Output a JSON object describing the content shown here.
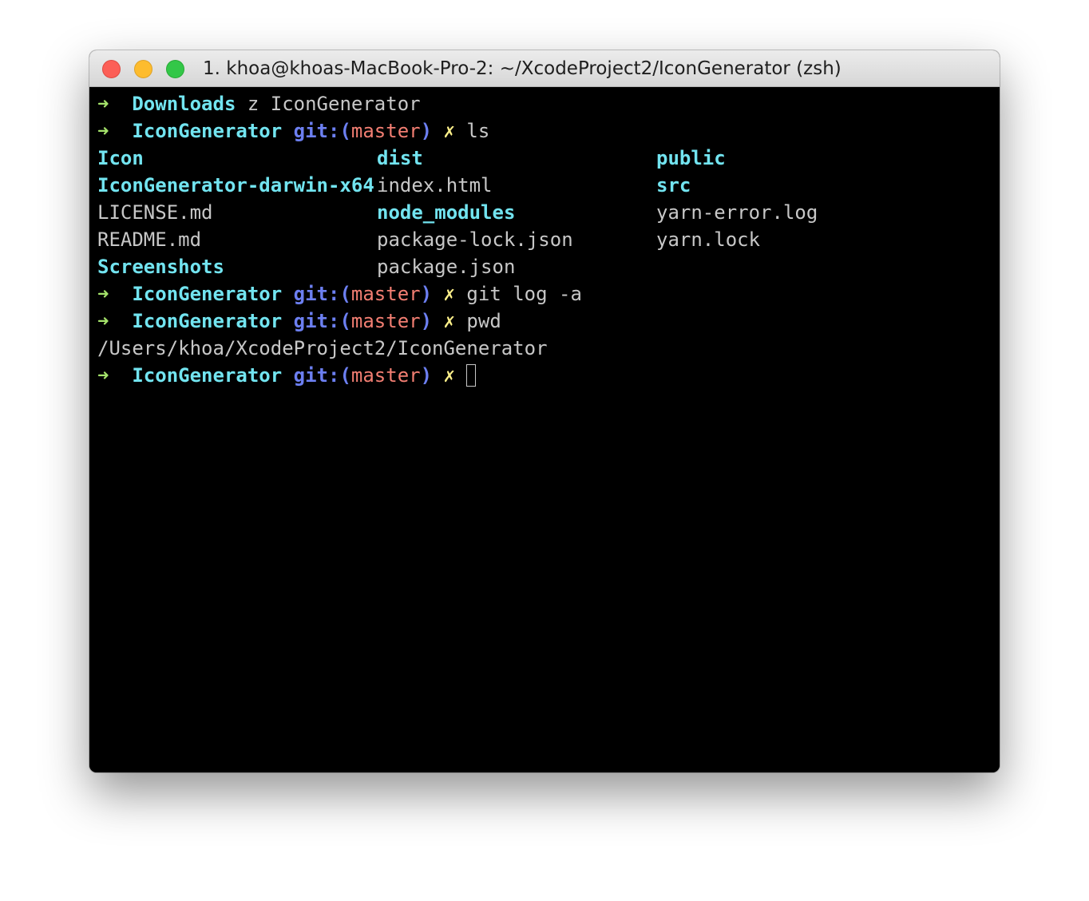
{
  "window": {
    "title": "1. khoa@khoas-MacBook-Pro-2: ~/XcodeProject2/IconGenerator (zsh)"
  },
  "colors": {
    "arrow": "#a5e36b",
    "directory": "#72e4f0",
    "git": "#6c7ff1",
    "branch": "#f27e72",
    "dirty": "#fdf08a",
    "text": "#c7c7c7",
    "background": "#000000"
  },
  "prompt": {
    "arrow": "➜",
    "git_open": "git:(",
    "branch": "master",
    "git_close": ")",
    "dirty": "✗"
  },
  "lines": {
    "l1": {
      "dir": "Downloads",
      "command": "z IconGenerator"
    },
    "l2": {
      "dir": "IconGenerator",
      "command": "ls"
    },
    "l8": {
      "dir": "IconGenerator",
      "command": "git log -a"
    },
    "l9": {
      "dir": "IconGenerator",
      "command": "pwd"
    },
    "l10": {
      "output": "/Users/khoa/XcodeProject2/IconGenerator"
    },
    "l11": {
      "dir": "IconGenerator",
      "command": ""
    }
  },
  "ls_output": [
    [
      "Icon",
      "dist",
      "public"
    ],
    [
      "IconGenerator-darwin-x64",
      "index.html",
      "src"
    ],
    [
      "LICENSE.md",
      "node_modules",
      "yarn-error.log"
    ],
    [
      "README.md",
      "package-lock.json",
      "yarn.lock"
    ],
    [
      "Screenshots",
      "package.json",
      ""
    ]
  ]
}
